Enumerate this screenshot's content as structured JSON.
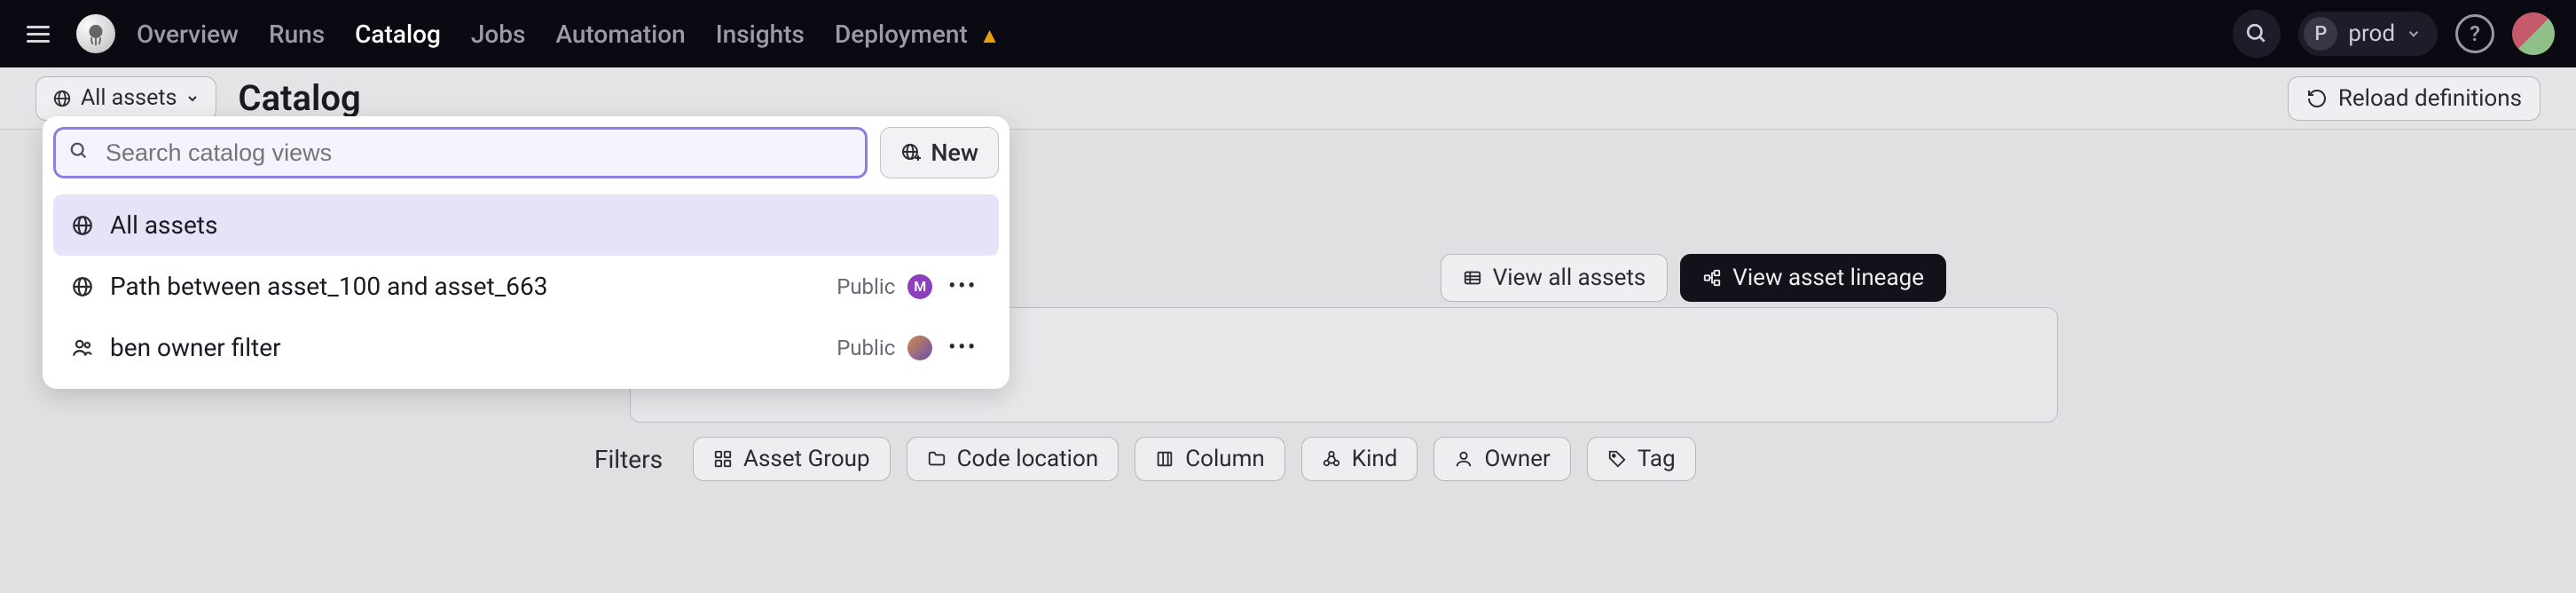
{
  "nav": {
    "links": [
      {
        "label": "Overview",
        "active": false
      },
      {
        "label": "Runs",
        "active": false
      },
      {
        "label": "Catalog",
        "active": true
      },
      {
        "label": "Jobs",
        "active": false
      },
      {
        "label": "Automation",
        "active": false
      },
      {
        "label": "Insights",
        "active": false
      },
      {
        "label": "Deployment",
        "active": false,
        "warn": true
      }
    ],
    "env_letter": "P",
    "env_name": "prod"
  },
  "header": {
    "dropdown_label": "All assets",
    "title": "Catalog",
    "reload_label": "Reload definitions"
  },
  "dd": {
    "search_placeholder": "Search catalog views",
    "new_label": "New",
    "items": [
      {
        "label": "All assets",
        "visibility": "",
        "badge": "",
        "menu": false,
        "icon": "globe"
      },
      {
        "label": "Path between asset_100 and asset_663",
        "visibility": "Public",
        "badge": "M",
        "menu": true,
        "icon": "globe"
      },
      {
        "label": "ben owner filter",
        "visibility": "Public",
        "badge": "user",
        "menu": true,
        "icon": "people"
      }
    ]
  },
  "views": {
    "all": "View all assets",
    "lineage": "View asset lineage"
  },
  "filters": {
    "label": "Filters",
    "chips": [
      "Asset Group",
      "Code location",
      "Column",
      "Kind",
      "Owner",
      "Tag"
    ]
  }
}
